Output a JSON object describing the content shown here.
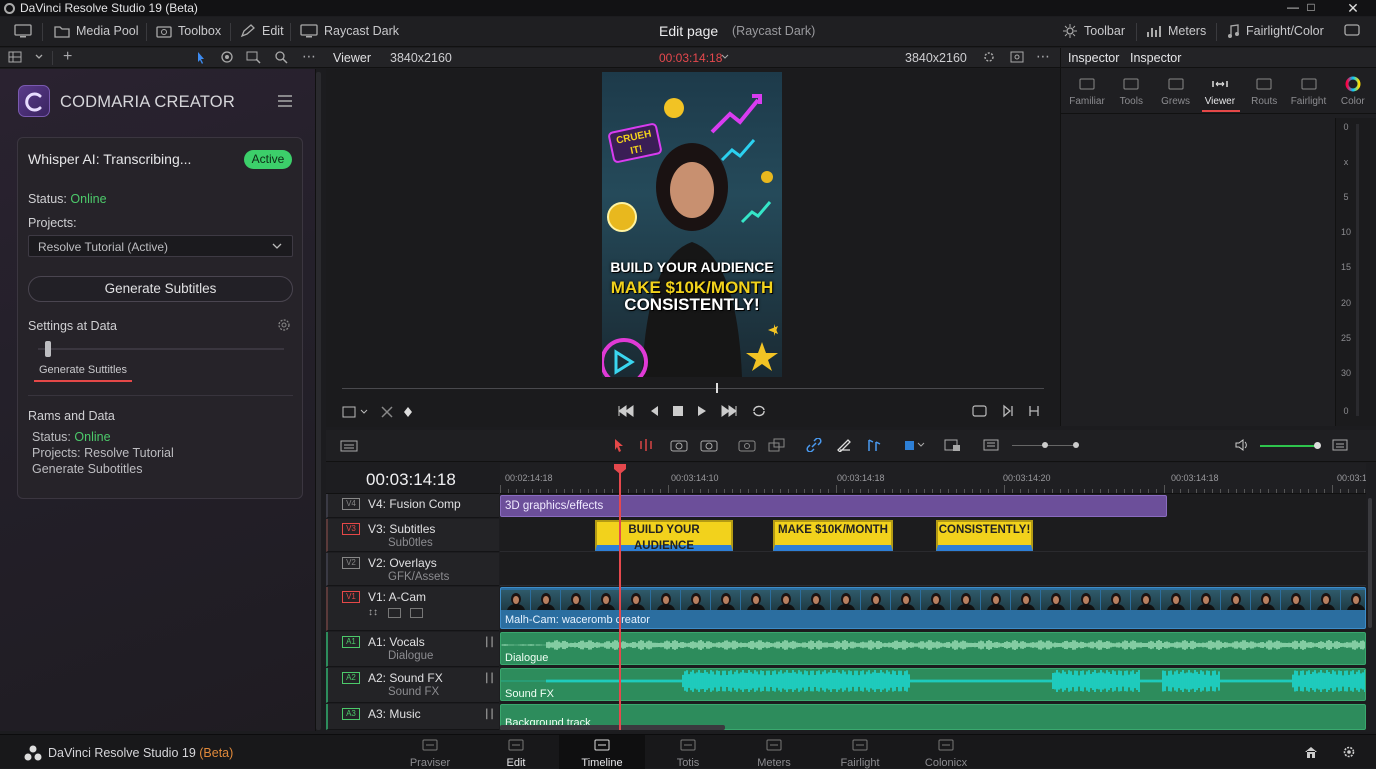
{
  "window": {
    "title": "DaVinci Resolve Studio 19 (Beta)"
  },
  "menubar": {
    "media_pool": "Media Pool",
    "toolbox": "Toolbox",
    "edit": "Edit",
    "raycast": "Raycast Dark",
    "page_title": "Edit page",
    "page_subtitle": "(Raycast Dark)",
    "toolbar": "Toolbar",
    "meters": "Meters",
    "fairlight": "Fairlight/Color"
  },
  "viewer_bar": {
    "viewer_label": "Viewer",
    "resolution_left": "3840x2160",
    "timecode": "00:03:14:18",
    "resolution_right": "3840x2160"
  },
  "inspector": {
    "tab1": "Inspector",
    "tab2": "Inspector",
    "tools": [
      {
        "label": "Familiar"
      },
      {
        "label": "Tools"
      },
      {
        "label": "Grews"
      },
      {
        "label": "Viewer"
      },
      {
        "label": "Routs"
      },
      {
        "label": "Fairlight"
      },
      {
        "label": "Color"
      }
    ],
    "meter_scale": [
      "0",
      "x",
      "5",
      "10",
      "15",
      "20",
      "25",
      "30",
      "0"
    ]
  },
  "plugin": {
    "brand": "CODMARIA CREATOR",
    "status_title": "Whisper AI: Transcribing...",
    "badge": "Active",
    "status_label": "Status:",
    "status_value": "Online",
    "projects_label": "Projects:",
    "project_select": "Resolve Tutorial (Active)",
    "generate_button": "Generate Subtitles",
    "settings_label": "Settings at Data",
    "generate_link": "Generate Suttitles",
    "rams_title": "Rams and Data",
    "rams_status_label": "Status:",
    "rams_status_value": "Online",
    "rams_projects": "Projects: Resolve Tutorial",
    "rams_generate": "Generate Subotitles",
    "slider_value": 0.04
  },
  "video": {
    "sticker": "CRUEH IT!",
    "line1": "BUILD YOUR AUDIENCE",
    "line2": "MAKE $10K/MONTH",
    "line3": "CONSISTENTLY!"
  },
  "timeline": {
    "timecode": "00:03:14:18",
    "ruler": [
      "00:02:14:18",
      "00:03:14:10",
      "00:03:14:18",
      "00:03:14:20",
      "00:03:14:18",
      "00:03:1"
    ],
    "tracks": [
      {
        "tag": "V4",
        "name": "V4: Fusion Comp",
        "sub": ""
      },
      {
        "tag": "V3",
        "name": "V3: Subtitles",
        "sub": "Sub0tles"
      },
      {
        "tag": "V2",
        "name": "V2: Overlays",
        "sub": "GFK/Assets"
      },
      {
        "tag": "V1",
        "name": "V1: A-Cam",
        "sub": ""
      },
      {
        "tag": "A1",
        "name": "A1: Vocals",
        "sub": "Dialogue"
      },
      {
        "tag": "A2",
        "name": "A2: Sound FX",
        "sub": "Sound FX"
      },
      {
        "tag": "A3",
        "name": "A3: Music",
        "sub": ""
      }
    ],
    "clips": {
      "fusion": "3D graphics/effects",
      "sub1": "BUILD YOUR AUDIENCE",
      "sub2": "MAKE $10K/MONTH",
      "sub3": "CONSISTENTLY!",
      "video": "Malh-Cam: waceromb creator",
      "dialogue": "Dialogue",
      "soundfx": "Sound FX",
      "music": "Backgroupd track"
    }
  },
  "taskbar": {
    "app": "DaVinci Resolve Studio 19 ",
    "beta": "(Beta)",
    "tabs": [
      {
        "label": "Praviser"
      },
      {
        "label": "Edit"
      },
      {
        "label": "Timeline"
      },
      {
        "label": "Totis"
      },
      {
        "label": "Meters"
      },
      {
        "label": "Fairlight"
      },
      {
        "label": "Colonicx"
      }
    ]
  },
  "colors": {
    "accent_red": "#e54848",
    "online_green": "#4cc96a",
    "subtitle_yellow": "#f2d21c",
    "audio_cyan": "#19e6e6",
    "fusion_purple": "#6c4f9a"
  }
}
